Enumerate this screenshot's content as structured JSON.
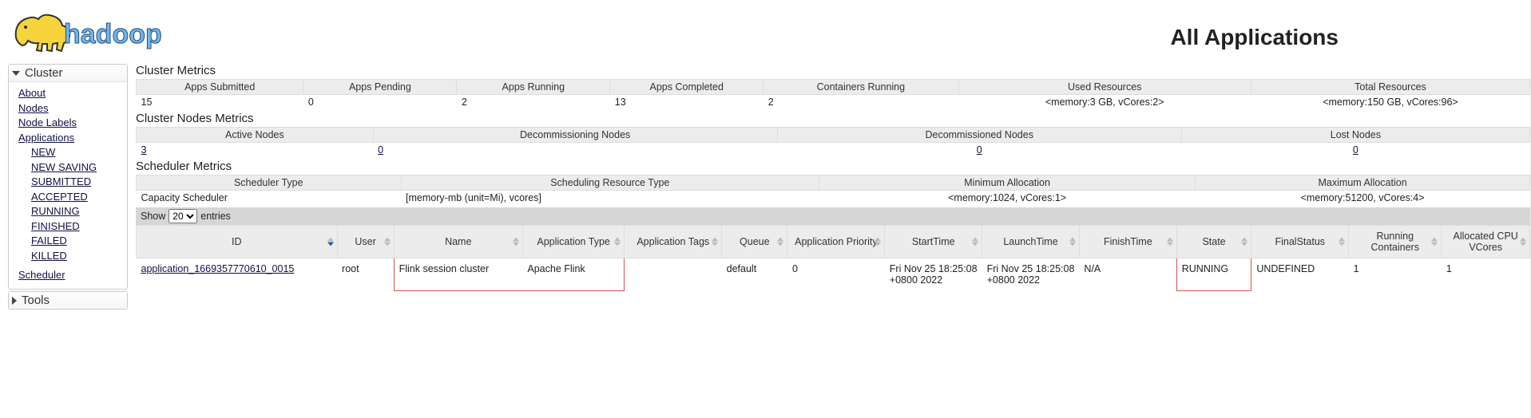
{
  "page_title": "All Applications",
  "sidebar": {
    "cluster_title": "Cluster",
    "tools_title": "Tools",
    "links": {
      "about": "About",
      "nodes": "Nodes",
      "node_labels": "Node Labels",
      "applications": "Applications",
      "new": "NEW",
      "new_saving": "NEW SAVING",
      "submitted": "SUBMITTED",
      "accepted": "ACCEPTED",
      "running": "RUNNING",
      "finished": "FINISHED",
      "failed": "FAILED",
      "killed": "KILLED",
      "scheduler": "Scheduler"
    }
  },
  "cluster_metrics": {
    "title": "Cluster Metrics",
    "headers": [
      "Apps Submitted",
      "Apps Pending",
      "Apps Running",
      "Apps Completed",
      "Containers Running",
      "Used Resources",
      "Total Resources"
    ],
    "values": [
      "15",
      "0",
      "2",
      "13",
      "2",
      "<memory:3 GB, vCores:2>",
      "<memory:150 GB, vCores:96>"
    ]
  },
  "nodes_metrics": {
    "title": "Cluster Nodes Metrics",
    "headers": [
      "Active Nodes",
      "Decommissioning Nodes",
      "Decommissioned Nodes",
      "Lost Nodes"
    ],
    "values": [
      "3",
      "0",
      "0",
      "0"
    ]
  },
  "sched_metrics": {
    "title": "Scheduler Metrics",
    "headers": [
      "Scheduler Type",
      "Scheduling Resource Type",
      "Minimum Allocation",
      "Maximum Allocation"
    ],
    "values": [
      "Capacity Scheduler",
      "[memory-mb (unit=Mi), vcores]",
      "<memory:1024, vCores:1>",
      "<memory:51200, vCores:4>"
    ]
  },
  "show": {
    "prefix": "Show",
    "value": "20",
    "suffix": "entries"
  },
  "apps_table": {
    "columns": [
      "ID",
      "User",
      "Name",
      "Application Type",
      "Application Tags",
      "Queue",
      "Application Priority",
      "StartTime",
      "LaunchTime",
      "FinishTime",
      "State",
      "FinalStatus",
      "Running Containers",
      "Allocated CPU VCores"
    ],
    "rows": [
      {
        "id": "application_1669357770610_0015",
        "user": "root",
        "name": "Flink session cluster",
        "app_type": "Apache Flink",
        "tags": "",
        "queue": "default",
        "priority": "0",
        "start_time": "Fri Nov 25 18:25:08 +0800 2022",
        "launch_time": "Fri Nov 25 18:25:08 +0800 2022",
        "finish_time": "N/A",
        "state": "RUNNING",
        "final_status": "UNDEFINED",
        "running_containers": "1",
        "vcores": "1"
      }
    ]
  }
}
